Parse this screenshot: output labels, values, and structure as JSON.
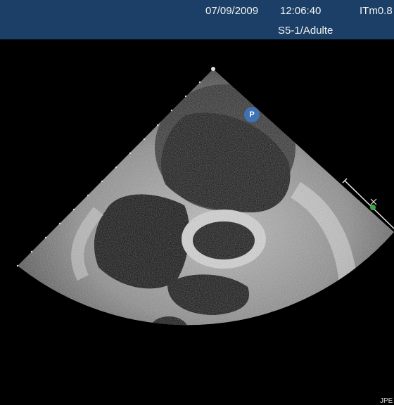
{
  "header": {
    "date": "07/09/2009",
    "time": "12:06:40",
    "index": "ITm0.8",
    "probe_preset": "S5-1/Adulte"
  },
  "image": {
    "orientation_marker": "P",
    "corner_label": "JPE"
  },
  "colors": {
    "header_background": "#1b3f66",
    "background": "#000000",
    "marker": "#3f72b3",
    "ecg_dot": "#3aa84a"
  },
  "icons": {
    "orientation_marker": "probe-orientation-marker",
    "depth_scale": "depth-scale-dots",
    "ecg_caliper": "ecg-caliper-icon"
  }
}
